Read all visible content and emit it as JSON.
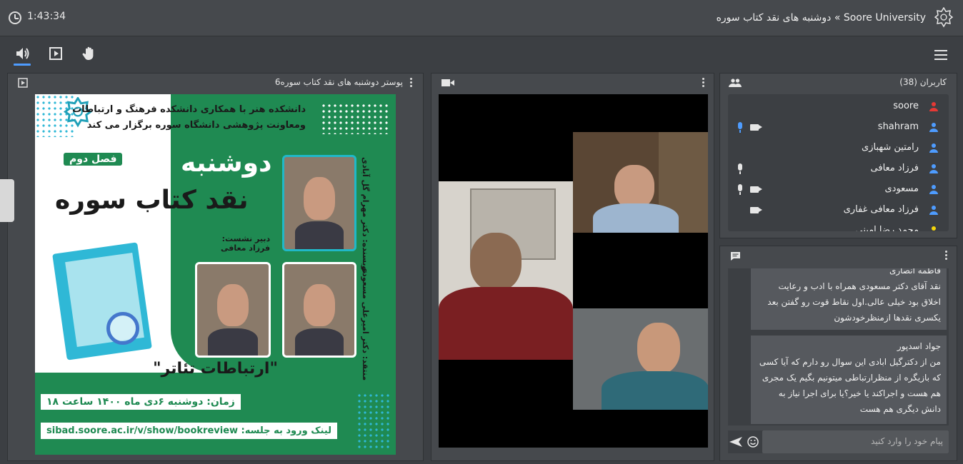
{
  "header": {
    "timer": "1:43:34",
    "title": "Soore University » دوشنبه های نقد کتاب سوره"
  },
  "toolbar": {
    "icons": [
      "speaker-icon",
      "play-screen-icon",
      "raise-hand-icon",
      "menu-icon"
    ]
  },
  "presentation": {
    "title": "پوستر دوشنبه های نقد کتاب سوره6",
    "poster": {
      "line1": "دانشکده هنر با همکاری دانشکده فرهنگ و ارتباطات",
      "line2": "ومعاونت پژوهشی دانشگاه سوره برگزار می کند",
      "big1": "دوشنبه هایِ",
      "big2": "نقد کتاب سوره",
      "season": "فصل دوم",
      "author_label": "نویسنده: دکتر مهرام گل آبادی",
      "critic_label": "منتقد: دکتر امیرعلی مسعودی",
      "secretary_label": "دبیر نشست:",
      "secretary_name": "فرزاد معافی",
      "quote": "\"ارتباطات تئاتر\"",
      "time": "زمان: دوشنبه ۶دی ماه ۱۴۰۰ ساعت ۱۸",
      "link": "لینک ورود به جلسه: sibad.soore.ac.ir/v/show/bookreview"
    }
  },
  "users": {
    "title": "کاربران (38)",
    "list": [
      {
        "name": "soore",
        "color": "#e53935",
        "mic": false,
        "cam": false
      },
      {
        "name": "shahram",
        "color": "#4e9cff",
        "mic": true,
        "micColor": "#4e9cff",
        "cam": true
      },
      {
        "name": "رامتین شهبازی",
        "color": "#4e9cff",
        "mic": false,
        "cam": false
      },
      {
        "name": "فرزاد معافی",
        "color": "#4e9cff",
        "mic": true,
        "micColor": "#e6e6e6",
        "cam": false
      },
      {
        "name": "مسعودی",
        "color": "#4e9cff",
        "mic": true,
        "micColor": "#e6e6e6",
        "cam": true
      },
      {
        "name": "فرزاد معافی غفاری",
        "color": "#4e9cff",
        "mic": false,
        "cam": true
      },
      {
        "name": "محمد رضا امینی",
        "color": "#f5d60a",
        "mic": false,
        "cam": false
      }
    ]
  },
  "chat": {
    "messages": [
      {
        "sender": "فاطمه انصاری",
        "text": "نقد آقای دکتر مسعودی همراه با ادب و رعایت اخلاق بود خیلی عالی.اول نقاط قوت رو گفتن بعد یکسری نقدها ازمنظرخودشون"
      },
      {
        "sender": "جواد اسدپور",
        "text": "من از دکترگیل ابادی این سوال رو دارم که آیا کسی که بازیگره از منظرارتباطی میتونیم بگیم یک مجری هم هست و اجراکند یا خیر؟یا برای اجرا نیاز به دانش دیگری هم هست"
      }
    ],
    "input_placeholder": "پیام خود را وارد کنید"
  }
}
